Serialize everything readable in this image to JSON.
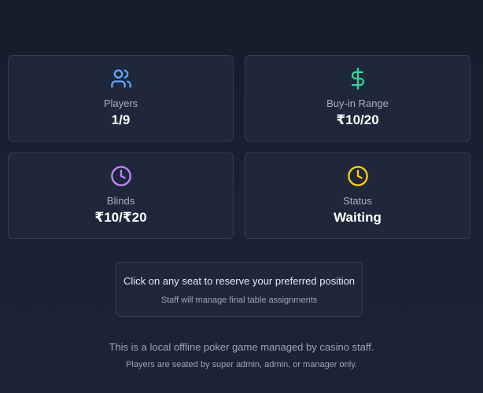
{
  "colors": {
    "players_icon": "#60a5fa",
    "buyin_icon": "#34d399",
    "blinds_icon": "#c084fc",
    "status_icon": "#facc15"
  },
  "stats": {
    "players": {
      "label": "Players",
      "value": "1/9",
      "icon": "users-icon"
    },
    "buyin": {
      "label": "Buy-in Range",
      "value": "₹10/20",
      "icon": "dollar-icon"
    },
    "blinds": {
      "label": "Blinds",
      "value": "₹10/₹20",
      "icon": "clock-icon"
    },
    "status": {
      "label": "Status",
      "value": "Waiting",
      "icon": "clock-icon"
    }
  },
  "notice": {
    "main": "Click on any seat to reserve your preferred position",
    "sub": "Staff will manage final table assignments"
  },
  "footer": {
    "line1": "This is a local offline poker game managed by casino staff.",
    "line2": "Players are seated by super admin, admin, or manager only."
  }
}
